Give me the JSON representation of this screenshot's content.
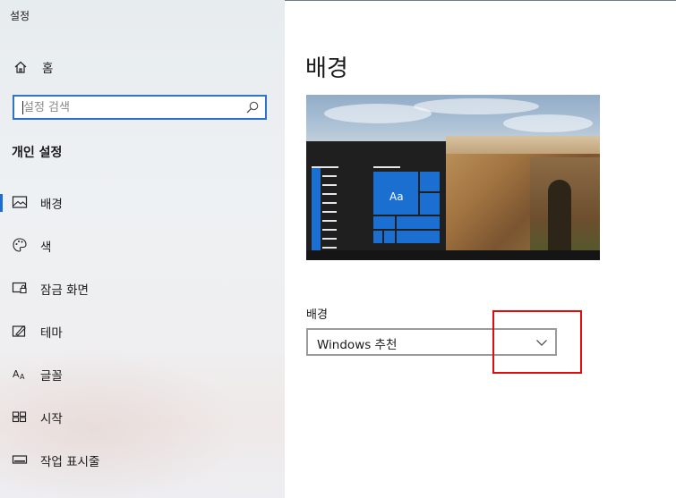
{
  "window": {
    "title": "설정"
  },
  "sidebar": {
    "home_label": "홈",
    "search_placeholder": "설정 검색",
    "section_title": "개인 설정",
    "items": [
      {
        "label": "배경",
        "icon": "picture-icon",
        "active": true
      },
      {
        "label": "색",
        "icon": "palette-icon",
        "active": false
      },
      {
        "label": "잠금 화면",
        "icon": "lock-screen-icon",
        "active": false
      },
      {
        "label": "테마",
        "icon": "theme-brush-icon",
        "active": false
      },
      {
        "label": "글꼴",
        "icon": "font-icon",
        "active": false
      },
      {
        "label": "시작",
        "icon": "start-grid-icon",
        "active": false
      },
      {
        "label": "작업 표시줄",
        "icon": "taskbar-icon",
        "active": false
      }
    ]
  },
  "main": {
    "title": "배경",
    "preview": {
      "tile_text": "Aa"
    },
    "background_label": "배경",
    "background_dropdown_value": "Windows 추천"
  },
  "colors": {
    "accent": "#1a6fd0",
    "highlight_box": "#e10c0c",
    "search_border": "#2e73c6"
  }
}
